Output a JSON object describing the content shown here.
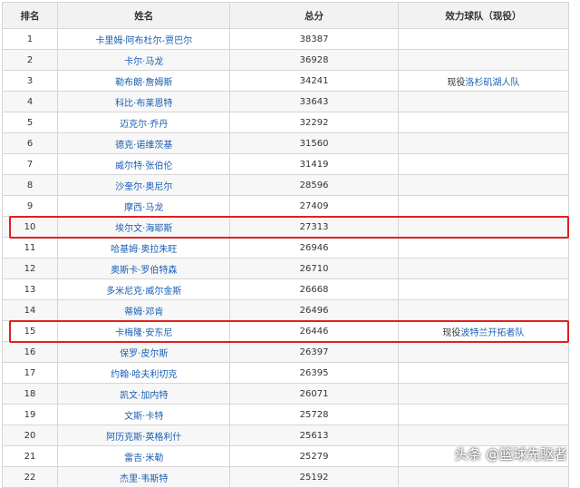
{
  "table": {
    "headers": [
      "排名",
      "姓名",
      "总分",
      "效力球队（现役）"
    ],
    "rows": [
      {
        "rank": "1",
        "name": "卡里姆·阿布杜尔-贾巴尔",
        "score": "38387",
        "team_prefix": "",
        "team_link": ""
      },
      {
        "rank": "2",
        "name": "卡尔·马龙",
        "score": "36928",
        "team_prefix": "",
        "team_link": ""
      },
      {
        "rank": "3",
        "name": "勒布朗·詹姆斯",
        "score": "34241",
        "team_prefix": "现役",
        "team_link": "洛杉矶湖人队"
      },
      {
        "rank": "4",
        "name": "科比·布莱恩特",
        "score": "33643",
        "team_prefix": "",
        "team_link": ""
      },
      {
        "rank": "5",
        "name": "迈克尔·乔丹",
        "score": "32292",
        "team_prefix": "",
        "team_link": ""
      },
      {
        "rank": "6",
        "name": "德克·诺维茨基",
        "score": "31560",
        "team_prefix": "",
        "team_link": ""
      },
      {
        "rank": "7",
        "name": "威尔特·张伯伦",
        "score": "31419",
        "team_prefix": "",
        "team_link": ""
      },
      {
        "rank": "8",
        "name": "沙奎尔·奥尼尔",
        "score": "28596",
        "team_prefix": "",
        "team_link": ""
      },
      {
        "rank": "9",
        "name": "摩西·马龙",
        "score": "27409",
        "team_prefix": "",
        "team_link": ""
      },
      {
        "rank": "10",
        "name": "埃尔文·海耶斯",
        "score": "27313",
        "team_prefix": "",
        "team_link": ""
      },
      {
        "rank": "11",
        "name": "哈基姆·奥拉朱旺",
        "score": "26946",
        "team_prefix": "",
        "team_link": ""
      },
      {
        "rank": "12",
        "name": "奥斯卡·罗伯特森",
        "score": "26710",
        "team_prefix": "",
        "team_link": ""
      },
      {
        "rank": "13",
        "name": "多米尼克·威尔金斯",
        "score": "26668",
        "team_prefix": "",
        "team_link": ""
      },
      {
        "rank": "14",
        "name": "蒂姆·邓肯",
        "score": "26496",
        "team_prefix": "",
        "team_link": ""
      },
      {
        "rank": "15",
        "name": "卡梅隆·安东尼",
        "score": "26446",
        "team_prefix": "现役",
        "team_link": "波特兰开拓者队"
      },
      {
        "rank": "16",
        "name": "保罗·皮尔斯",
        "score": "26397",
        "team_prefix": "",
        "team_link": ""
      },
      {
        "rank": "17",
        "name": "约翰·哈夫利切克",
        "score": "26395",
        "team_prefix": "",
        "team_link": ""
      },
      {
        "rank": "18",
        "name": "凯文·加内特",
        "score": "26071",
        "team_prefix": "",
        "team_link": ""
      },
      {
        "rank": "19",
        "name": "文斯·卡特",
        "score": "25728",
        "team_prefix": "",
        "team_link": ""
      },
      {
        "rank": "20",
        "name": "阿历克斯·英格利什",
        "score": "25613",
        "team_prefix": "",
        "team_link": ""
      },
      {
        "rank": "21",
        "name": "雷吉·米勒",
        "score": "25279",
        "team_prefix": "",
        "team_link": ""
      },
      {
        "rank": "22",
        "name": "杰里·韦斯特",
        "score": "25192",
        "team_prefix": "",
        "team_link": ""
      }
    ]
  },
  "highlighted_ranks": [
    "10",
    "15"
  ],
  "watermark": "头条 @篮球先驱者",
  "colors": {
    "link": "#1a5fb4",
    "highlight": "#e02020",
    "header_bg": "#f2f2f2",
    "border": "#d6d6d6"
  }
}
